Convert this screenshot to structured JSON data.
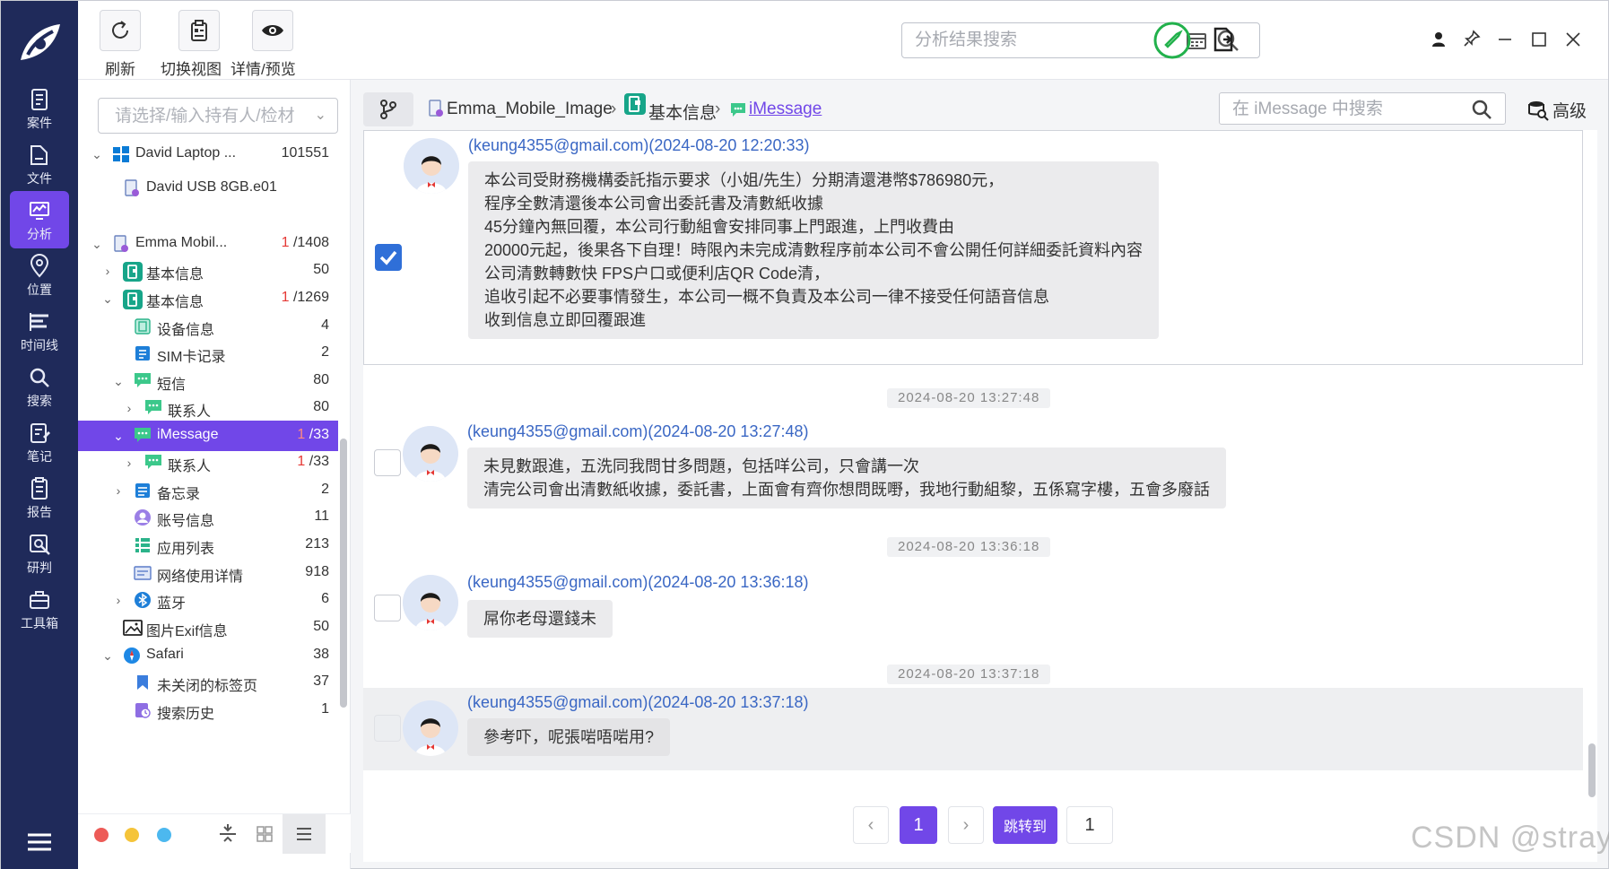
{
  "nav": {
    "items": [
      {
        "label": "案件",
        "icon": "case-icon"
      },
      {
        "label": "文件",
        "icon": "file-icon"
      },
      {
        "label": "分析",
        "icon": "analysis-icon"
      },
      {
        "label": "位置",
        "icon": "location-icon"
      },
      {
        "label": "时间线",
        "icon": "timeline-icon"
      },
      {
        "label": "搜索",
        "icon": "search-icon"
      },
      {
        "label": "笔记",
        "icon": "note-icon"
      },
      {
        "label": "报告",
        "icon": "report-icon"
      },
      {
        "label": "研判",
        "icon": "judge-icon"
      },
      {
        "label": "工具箱",
        "icon": "toolbox-icon"
      }
    ],
    "active_index": 2
  },
  "toolbar": {
    "refresh_label": "刷新",
    "switch_view_label": "切换视图",
    "details_label": "详情/预览",
    "search_placeholder": "分析结果搜索"
  },
  "tree": {
    "holder_placeholder": "请选择/输入持有人/检材",
    "rows": [
      {
        "label": "David Laptop ...",
        "count": "101551",
        "count_red": ""
      },
      {
        "label": "David USB 8GB.e01",
        "count": "",
        "count_red": ""
      },
      {
        "label": "Emma Mobil...",
        "count": "/1408",
        "count_red": "1"
      },
      {
        "label": "基本信息",
        "count": "50",
        "count_red": ""
      },
      {
        "label": "基本信息",
        "count": "/1269",
        "count_red": "1"
      },
      {
        "label": "设备信息",
        "count": "4",
        "count_red": ""
      },
      {
        "label": "SIM卡记录",
        "count": "2",
        "count_red": ""
      },
      {
        "label": "短信",
        "count": "80",
        "count_red": ""
      },
      {
        "label": "联系人",
        "count": "80",
        "count_red": ""
      },
      {
        "label": "iMessage",
        "count": "/33",
        "count_red": "1"
      },
      {
        "label": "联系人",
        "count": "/33",
        "count_red": "1"
      },
      {
        "label": "备忘录",
        "count": "2",
        "count_red": ""
      },
      {
        "label": "账号信息",
        "count": "11",
        "count_red": ""
      },
      {
        "label": "应用列表",
        "count": "213",
        "count_red": ""
      },
      {
        "label": "网络使用详情",
        "count": "918",
        "count_red": ""
      },
      {
        "label": "蓝牙",
        "count": "6",
        "count_red": ""
      },
      {
        "label": "图片Exif信息",
        "count": "50",
        "count_red": ""
      },
      {
        "label": "Safari",
        "count": "38",
        "count_red": ""
      },
      {
        "label": "未关闭的标签页",
        "count": "37",
        "count_red": ""
      },
      {
        "label": "搜索历史",
        "count": "1",
        "count_red": ""
      }
    ]
  },
  "breadcrumb": {
    "items": [
      "Emma_Mobile_Image",
      "基本信息",
      "iMessage"
    ],
    "search_placeholder": "在 iMessage 中搜索",
    "advanced_label": "高级"
  },
  "messages": [
    {
      "sender": "(keung4355@gmail.com)(2024-08-20 12:20:33)",
      "lines": [
        "本公司受財務機構委託指示要求（小姐/先生）分期清還港幣$786980元，",
        "程序全數清還後本公司會出委託書及清數紙收據",
        "45分鐘內無回覆，本公司行動組會安排同事上門跟進，上門收費由",
        "20000元起，後果各下自理！時限內未完成清數程序前本公司不會公開任何詳細委託資料內容",
        "公司清數轉數快 FPS户口或便利店QR Code清，",
        "追收引起不必要事情發生，本公司一概不負責及本公司一律不接受任何語音信息",
        "收到信息立即回覆跟進"
      ],
      "checked": true
    },
    {
      "timestamp": "2024-08-20 13:27:48",
      "sender": "(keung4355@gmail.com)(2024-08-20 13:27:48)",
      "lines": [
        "未見數跟進，五洗同我問甘多問題，包括咩公司，只會講一次",
        "清完公司會出清數紙收據，委託書，上面會有齊你想問既嘢，我地行動組黎，五係寫字樓，五會多廢話"
      ],
      "checked": false
    },
    {
      "timestamp": "2024-08-20 13:36:18",
      "sender": "(keung4355@gmail.com)(2024-08-20 13:36:18)",
      "lines": [
        "屌你老母還錢未"
      ],
      "checked": false
    },
    {
      "timestamp": "2024-08-20 13:37:18",
      "sender": "(keung4355@gmail.com)(2024-08-20 13:37:18)",
      "lines": [
        "參考吓，呢張啱唔啱用?"
      ],
      "checked": false
    }
  ],
  "pagination": {
    "current": "1",
    "jump_label": "跳转到",
    "jump_value": "1"
  },
  "watermark": "CSDN @stray l",
  "colors": {
    "nav_bg": "#1f2a5a",
    "accent": "#7147e8",
    "link": "#3a67c4",
    "checkbox": "#2f6fd8",
    "badge_red": "#e53935"
  }
}
